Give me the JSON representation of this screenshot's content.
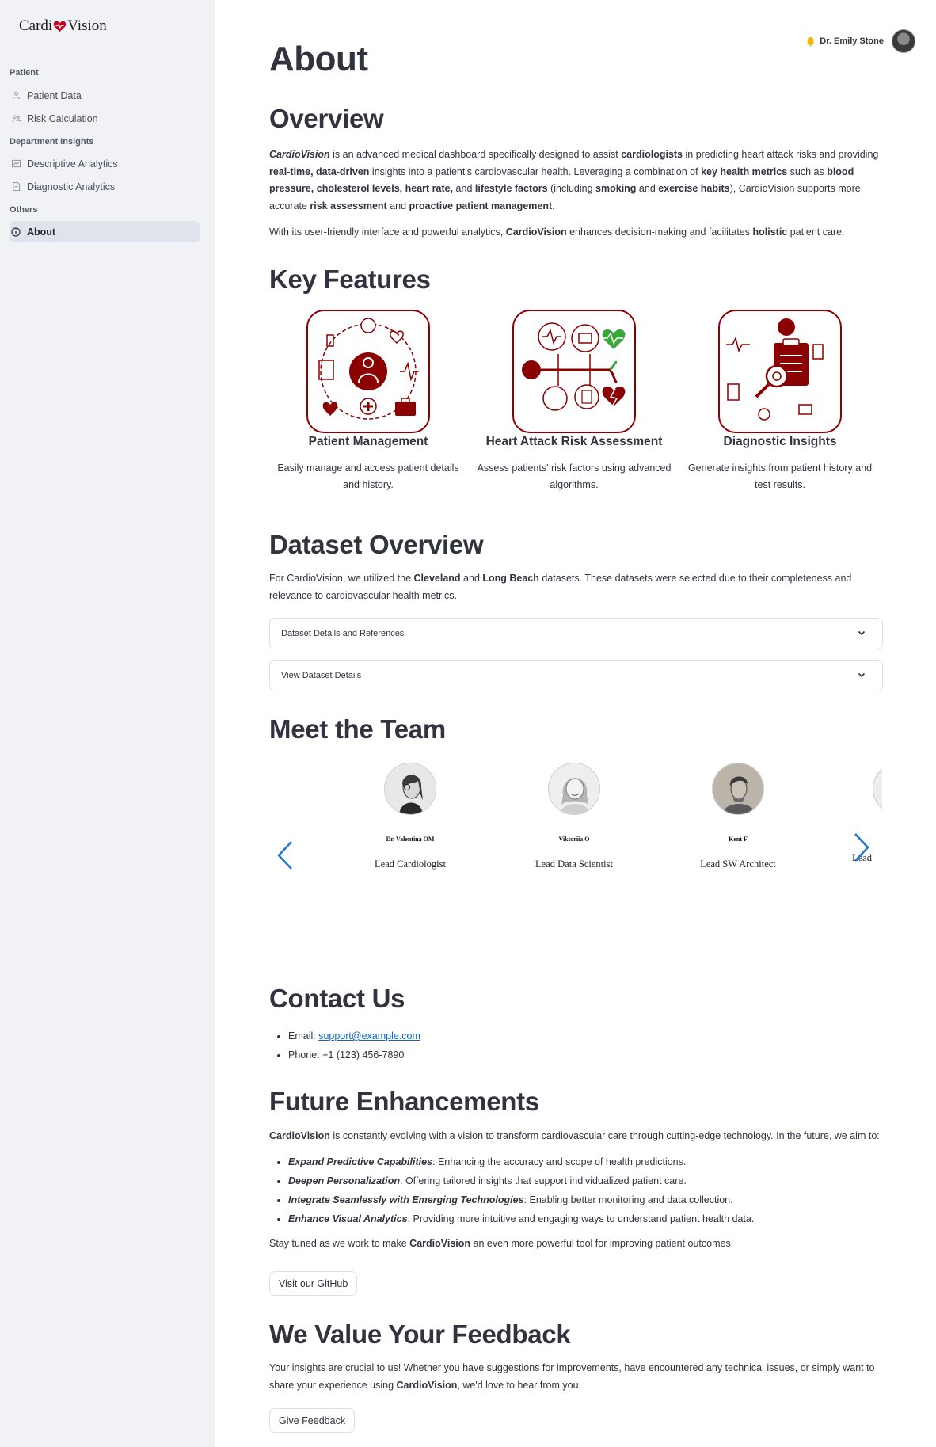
{
  "sidebar": {
    "logo": {
      "left": "Cardi",
      "right": "Vision"
    },
    "sections": [
      {
        "title": "Patient"
      },
      {
        "title": "Department Insights"
      },
      {
        "title": "Others"
      }
    ],
    "items": [
      {
        "label": "Patient Data",
        "icon": "person-icon"
      },
      {
        "label": "Risk Calculation",
        "icon": "people-icon"
      },
      {
        "label": "Descriptive Analytics",
        "icon": "chart-icon"
      },
      {
        "label": "Diagnostic Analytics",
        "icon": "document-icon"
      },
      {
        "label": "About",
        "icon": "info-icon",
        "active": true
      }
    ]
  },
  "header": {
    "user_name": "Dr. Emily Stone",
    "notification_icon": "bell-icon"
  },
  "main": {
    "title": "About",
    "overview": {
      "heading": "Overview",
      "p1_parts": [
        {
          "t": "CardioVision",
          "s": "bi"
        },
        {
          "t": " is an advanced medical dashboard specifically designed to assist ",
          "s": ""
        },
        {
          "t": "cardiologists",
          "s": "b"
        },
        {
          "t": " in predicting heart attack risks and providing ",
          "s": ""
        },
        {
          "t": "real-time, data-driven",
          "s": "b"
        },
        {
          "t": " insights into a patient's cardiovascular health. Leveraging a combination of ",
          "s": ""
        },
        {
          "t": "key health metrics",
          "s": "b"
        },
        {
          "t": " such as ",
          "s": ""
        },
        {
          "t": "blood pressure, cholesterol levels, heart rate,",
          "s": "b"
        },
        {
          "t": " and ",
          "s": ""
        },
        {
          "t": "lifestyle factors",
          "s": "b"
        },
        {
          "t": " (including ",
          "s": ""
        },
        {
          "t": "smoking",
          "s": "b"
        },
        {
          "t": " and ",
          "s": ""
        },
        {
          "t": "exercise habits",
          "s": "b"
        },
        {
          "t": "), CardioVision supports more accurate ",
          "s": ""
        },
        {
          "t": "risk assessment",
          "s": "b"
        },
        {
          "t": " and ",
          "s": ""
        },
        {
          "t": "proactive patient management",
          "s": "b"
        },
        {
          "t": ".",
          "s": ""
        }
      ],
      "p2_parts": [
        {
          "t": "With its user-friendly interface and powerful analytics, ",
          "s": ""
        },
        {
          "t": "CardioVision",
          "s": "b"
        },
        {
          "t": " enhances decision-making and facilitates ",
          "s": ""
        },
        {
          "t": "holistic",
          "s": "b"
        },
        {
          "t": " patient care.",
          "s": ""
        }
      ]
    },
    "key_features": {
      "heading": "Key Features",
      "items": [
        {
          "title": "Patient Management",
          "desc": "Easily manage and access patient details and history."
        },
        {
          "title": "Heart Attack Risk Assessment",
          "desc": "Assess patients' risk factors using advanced algorithms."
        },
        {
          "title": "Diagnostic Insights",
          "desc": "Generate insights from patient history and test results."
        }
      ]
    },
    "dataset": {
      "heading": "Dataset Overview",
      "p_parts": [
        {
          "t": "For CardioVision, we utilized the ",
          "s": ""
        },
        {
          "t": "Cleveland",
          "s": "b"
        },
        {
          "t": " and ",
          "s": ""
        },
        {
          "t": "Long Beach",
          "s": "b"
        },
        {
          "t": " datasets. These datasets were selected due to their completeness and relevance to cardiovascular health metrics.",
          "s": ""
        }
      ],
      "expanders": [
        "Dataset Details and References",
        "View Dataset Details"
      ]
    },
    "team": {
      "heading": "Meet the Team",
      "members": [
        {
          "name": "Dr. Valentina OM",
          "role": "Lead Cardiologist"
        },
        {
          "name": "Viktoriia O",
          "role": "Lead Data Scientist"
        },
        {
          "name": "Kent F",
          "role": "Lead SW Architect"
        }
      ],
      "partial_role": "Lead"
    },
    "contact": {
      "heading": "Contact Us",
      "email_label": "Email: ",
      "email": "support@example.com",
      "phone": "Phone: +1 (123) 456-7890"
    },
    "future": {
      "heading": "Future Enhancements",
      "intro_parts": [
        {
          "t": "CardioVision",
          "s": "b"
        },
        {
          "t": " is constantly evolving with a vision to transform cardiovascular care through cutting-edge technology. In the future, we aim to:",
          "s": ""
        }
      ],
      "items": [
        {
          "title": "Expand Predictive Capabilities",
          "text": ": Enhancing the accuracy and scope of health predictions."
        },
        {
          "title": "Deepen Personalization",
          "text": ": Offering tailored insights that support individualized patient care."
        },
        {
          "title": "Integrate Seamlessly with Emerging Technologies",
          "text": ": Enabling better monitoring and data collection."
        },
        {
          "title": "Enhance Visual Analytics",
          "text": ": Providing more intuitive and engaging ways to understand patient health data."
        }
      ],
      "outro_parts": [
        {
          "t": "Stay tuned as we work to make ",
          "s": ""
        },
        {
          "t": "CardioVision",
          "s": "b"
        },
        {
          "t": " an even more powerful tool for improving patient outcomes.",
          "s": ""
        }
      ],
      "button": "Visit our GitHub"
    },
    "feedback": {
      "heading": "We Value Your Feedback",
      "p_parts": [
        {
          "t": "Your insights are crucial to us! Whether you have suggestions for improvements, have encountered any technical issues, or simply want to share your experience using ",
          "s": ""
        },
        {
          "t": "CardioVision",
          "s": "b"
        },
        {
          "t": ", we'd love to hear from you.",
          "s": ""
        }
      ],
      "button": "Give Feedback"
    }
  },
  "colors": {
    "brand_red": "#8b0000",
    "accent_green": "#3aa53a",
    "link_blue": "#1565c0",
    "sidebar_bg": "#f0f2f6"
  }
}
